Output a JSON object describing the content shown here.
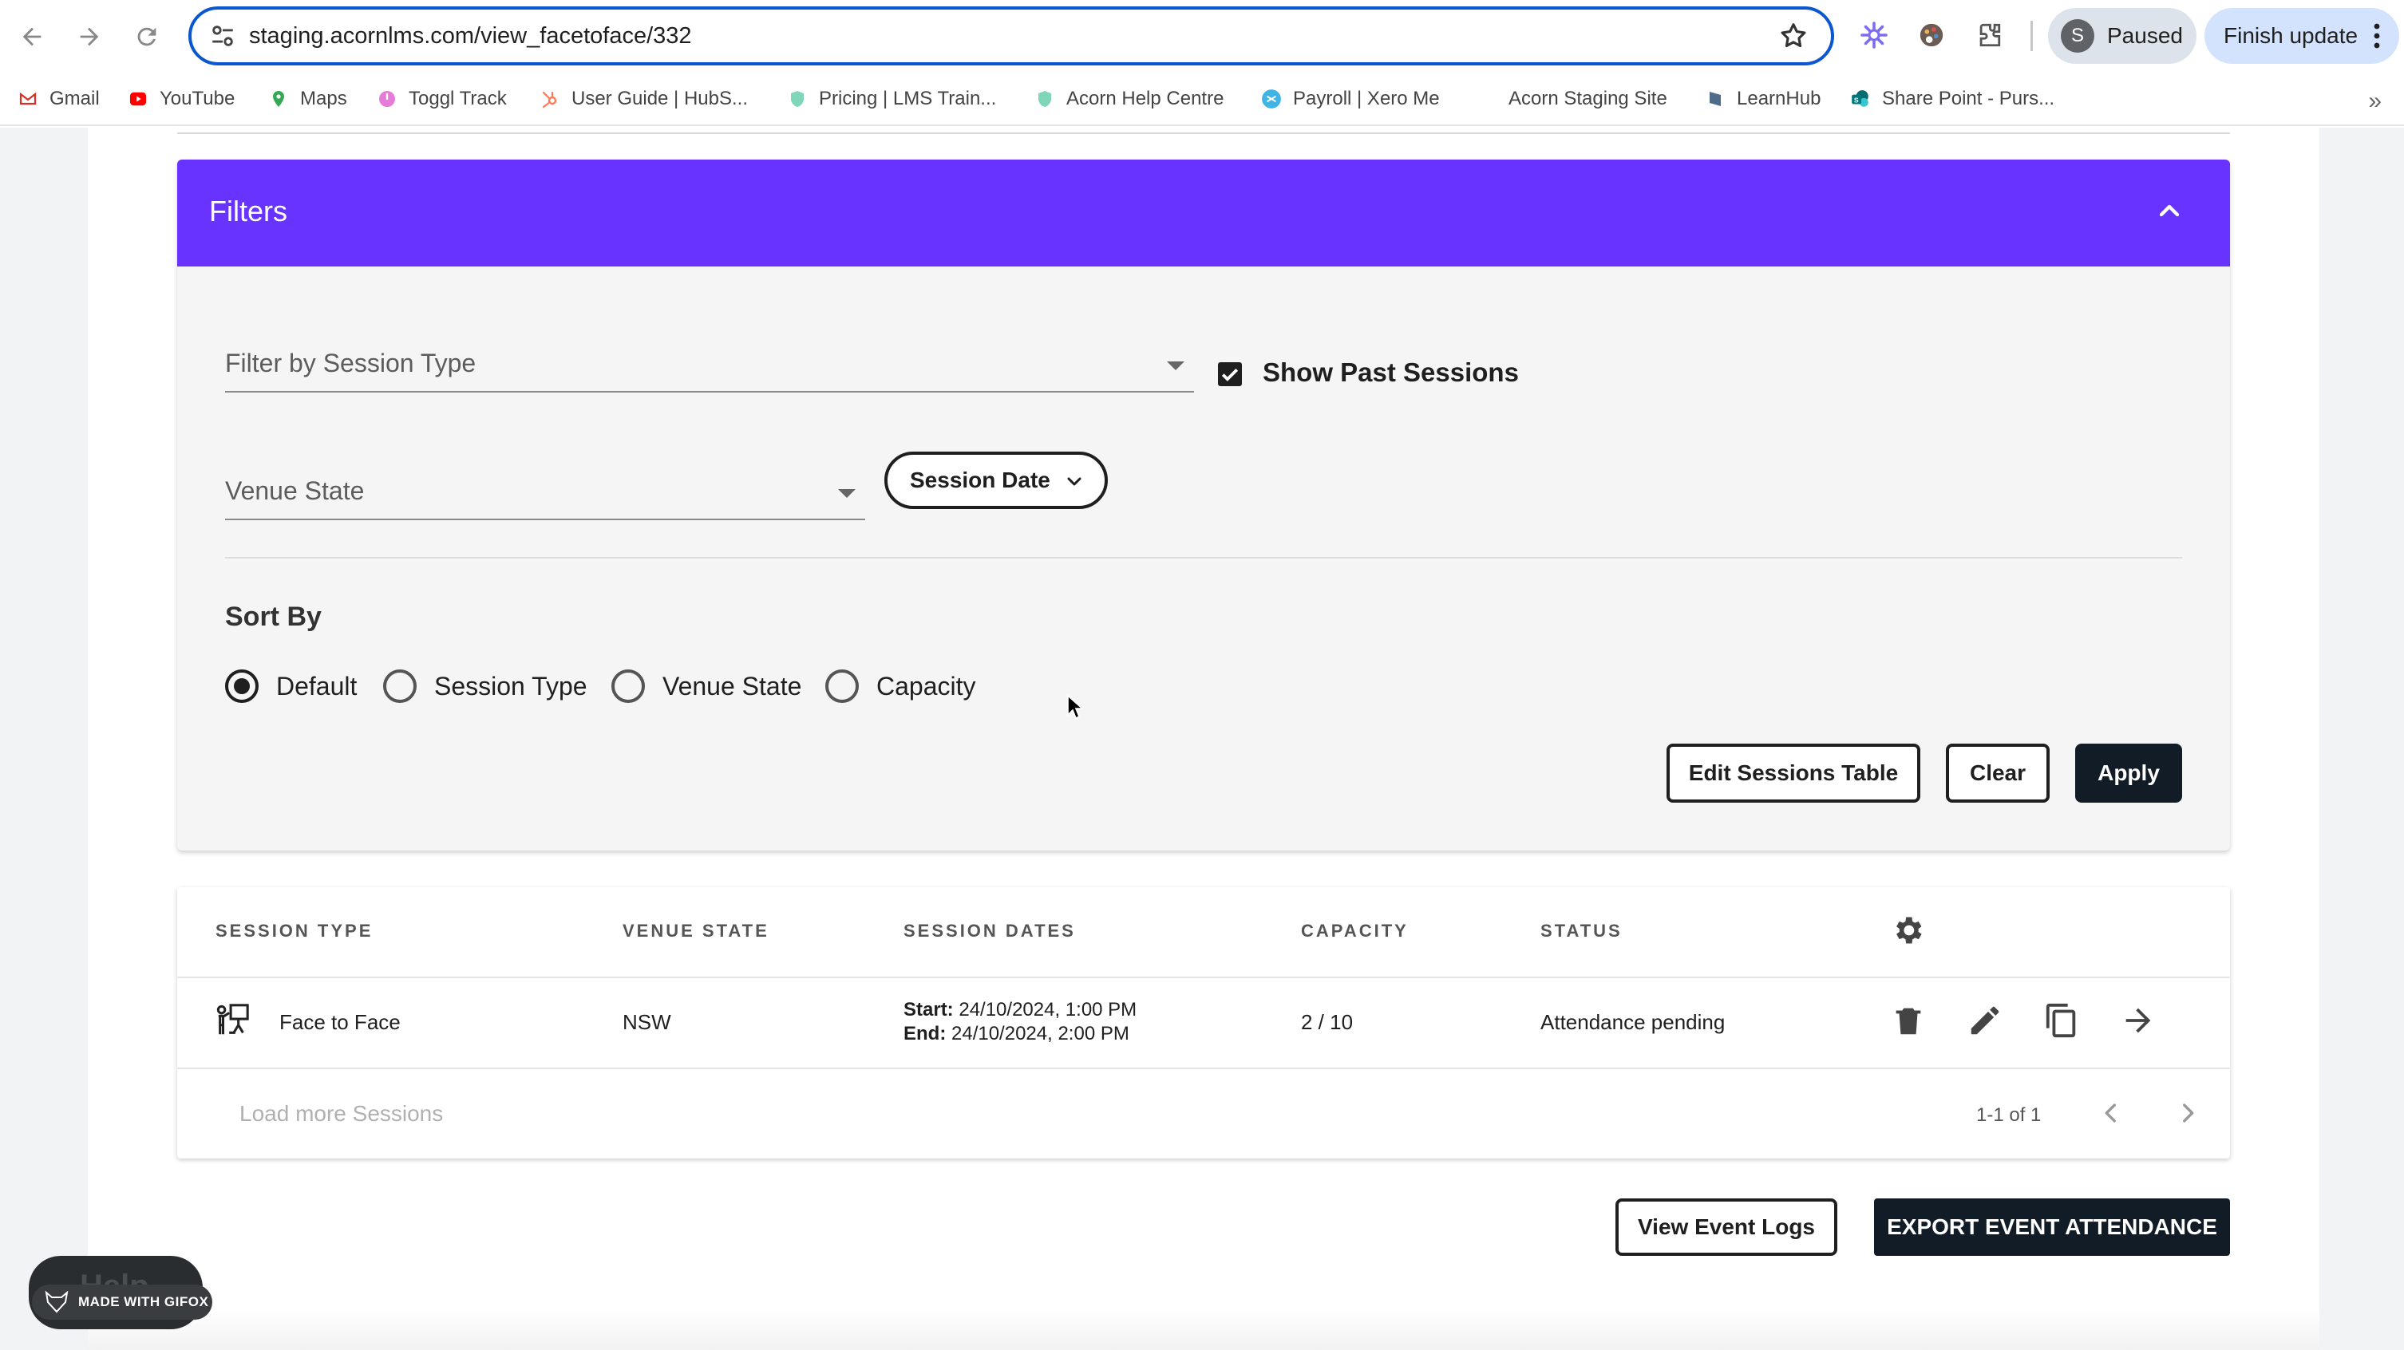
{
  "browser": {
    "url": "staging.acornlms.com/view_facetoface/332",
    "profile_initial": "S",
    "profile_status": "Paused",
    "update_label": "Finish update",
    "bookmarks": [
      {
        "label": "Gmail",
        "icon": "gmail-icon"
      },
      {
        "label": "YouTube",
        "icon": "youtube-icon"
      },
      {
        "label": "Maps",
        "icon": "maps-icon"
      },
      {
        "label": "Toggl Track",
        "icon": "toggl-icon"
      },
      {
        "label": "User Guide | HubS...",
        "icon": "hubspot-icon"
      },
      {
        "label": "Pricing | LMS Train...",
        "icon": "shield-icon"
      },
      {
        "label": "Acorn Help Centre",
        "icon": "shield-icon"
      },
      {
        "label": "Payroll | Xero Me",
        "icon": "xero-icon"
      },
      {
        "label": "Acorn Staging Site",
        "icon": "none"
      },
      {
        "label": "LearnHub",
        "icon": "learnhub-icon"
      },
      {
        "label": "Share Point - Purs...",
        "icon": "sharepoint-icon"
      }
    ]
  },
  "filters": {
    "title": "Filters",
    "session_type_placeholder": "Filter by Session Type",
    "show_past_label": "Show Past Sessions",
    "show_past_checked": true,
    "venue_state_placeholder": "Venue State",
    "session_date_label": "Session Date",
    "sort_by_title": "Sort By",
    "sort_options": [
      {
        "label": "Default",
        "selected": true
      },
      {
        "label": "Session Type",
        "selected": false
      },
      {
        "label": "Venue State",
        "selected": false
      },
      {
        "label": "Capacity",
        "selected": false
      }
    ],
    "edit_table_label": "Edit Sessions Table",
    "clear_label": "Clear",
    "apply_label": "Apply"
  },
  "sessions": {
    "headers": [
      "SESSION TYPE",
      "VENUE STATE",
      "SESSION DATES",
      "CAPACITY",
      "STATUS"
    ],
    "rows": [
      {
        "type": "Face to Face",
        "venue_state": "NSW",
        "start_label": "Start:",
        "start": "24/10/2024, 1:00 PM",
        "end_label": "End:",
        "end": "24/10/2024, 2:00 PM",
        "capacity": "2 / 10",
        "status": "Attendance pending"
      }
    ],
    "load_more_label": "Load more Sessions",
    "pagination": "1-1 of 1"
  },
  "footer": {
    "view_logs_label": "View Event Logs",
    "export_label": "EXPORT EVENT ATTENDANCE"
  },
  "overlay": {
    "gifox_label": "MADE WITH GIFOX",
    "help_label": "Help"
  },
  "colors": {
    "accent": "#6933ff",
    "focus": "#0b57d0",
    "dark_button": "#121c26"
  }
}
